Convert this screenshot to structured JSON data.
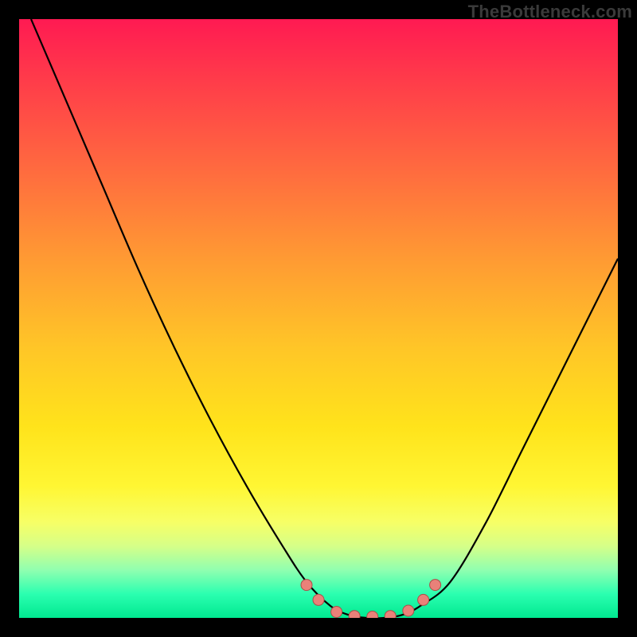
{
  "watermark": "TheBottleneck.com",
  "colors": {
    "curve": "#000000",
    "marker_fill": "#e98179",
    "marker_stroke": "#aa4f49",
    "background_black": "#000000"
  },
  "chart_data": {
    "type": "line",
    "title": "",
    "xlabel": "",
    "ylabel": "",
    "xlim": [
      0,
      100
    ],
    "ylim": [
      0,
      100
    ],
    "grid": false,
    "series": [
      {
        "name": "bottleneck-curve",
        "x": [
          2,
          8,
          14,
          20,
          26,
          32,
          38,
          44,
          48,
          52,
          55,
          58,
          61,
          64,
          67,
          72,
          78,
          84,
          90,
          96,
          100
        ],
        "y": [
          100,
          86,
          72,
          58,
          45,
          33,
          22,
          12,
          6,
          2,
          0.5,
          0,
          0,
          0.5,
          2,
          6,
          16,
          28,
          40,
          52,
          60
        ]
      }
    ],
    "markers": {
      "name": "highlight-dots",
      "x": [
        48,
        50,
        53,
        56,
        59,
        62,
        65,
        67.5,
        69.5
      ],
      "y": [
        5.5,
        3.0,
        1.0,
        0.3,
        0.2,
        0.3,
        1.2,
        3.0,
        5.5
      ],
      "r": 7
    },
    "gradient_stops": [
      {
        "pos": 0.0,
        "color": "#ff1a52"
      },
      {
        "pos": 0.1,
        "color": "#ff3b4a"
      },
      {
        "pos": 0.25,
        "color": "#ff6a3f"
      },
      {
        "pos": 0.4,
        "color": "#ff9a33"
      },
      {
        "pos": 0.55,
        "color": "#ffc627"
      },
      {
        "pos": 0.68,
        "color": "#ffe31b"
      },
      {
        "pos": 0.78,
        "color": "#fff633"
      },
      {
        "pos": 0.84,
        "color": "#f7ff66"
      },
      {
        "pos": 0.88,
        "color": "#d6ff88"
      },
      {
        "pos": 0.92,
        "color": "#90ffb0"
      },
      {
        "pos": 0.96,
        "color": "#2bffb0"
      },
      {
        "pos": 1.0,
        "color": "#00e890"
      }
    ]
  }
}
